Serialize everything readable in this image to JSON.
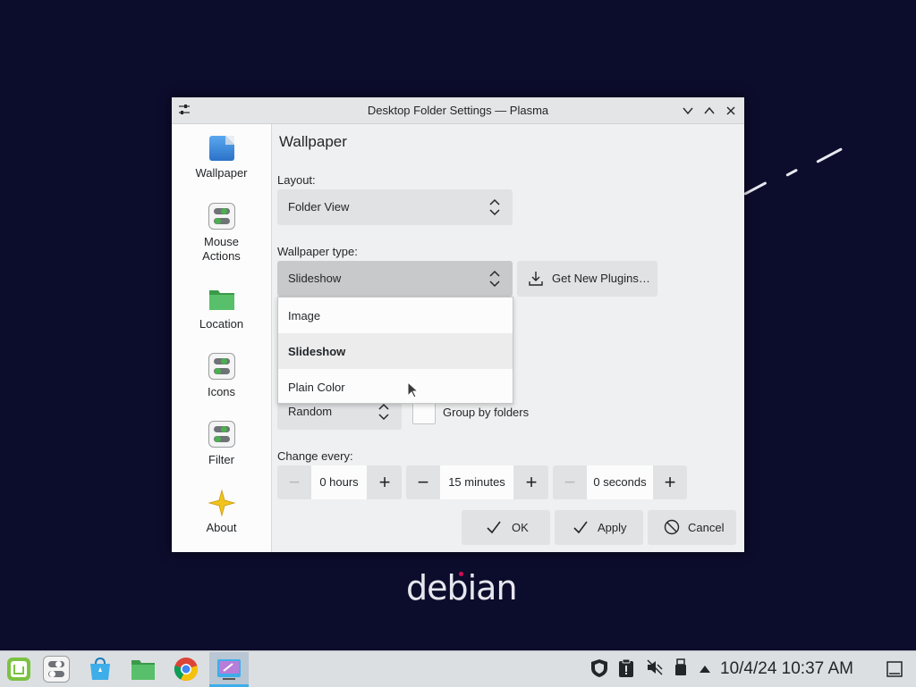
{
  "desktop": {
    "logo_text": "debian"
  },
  "window": {
    "title": "Desktop Folder Settings — Plasma",
    "controls": {
      "minimize": "∨",
      "maximize": "∧",
      "close": "✕"
    }
  },
  "sidebar": {
    "items": [
      {
        "label": "Wallpaper",
        "icon": "wallpaper-icon"
      },
      {
        "label": "Mouse\nActions",
        "icon": "toggle-icon"
      },
      {
        "label": "Location",
        "icon": "folder-icon"
      },
      {
        "label": "Icons",
        "icon": "toggle-icon"
      },
      {
        "label": "Filter",
        "icon": "toggle-icon"
      },
      {
        "label": "About",
        "icon": "star-icon"
      }
    ]
  },
  "main": {
    "title": "Wallpaper",
    "layout_label": "Layout:",
    "layout_value": "Folder View",
    "wallpaper_type_label": "Wallpaper type:",
    "wallpaper_type_value": "Slideshow",
    "get_plugins_label": "Get New Plugins…",
    "dropdown_options": [
      "Image",
      "Slideshow",
      "Plain Color"
    ],
    "dropdown_selected": "Slideshow",
    "order_value": "Random",
    "group_by_folders_label": "Group by folders",
    "group_by_folders_checked": false,
    "change_every_label": "Change every:",
    "hours_value": "0 hours",
    "minutes_value": "15 minutes",
    "seconds_value": "0 seconds",
    "minus_symbol": "−",
    "plus_symbol": "+"
  },
  "footer": {
    "ok_label": "OK",
    "apply_label": "Apply",
    "cancel_label": "Cancel"
  },
  "taskbar": {
    "clock": "10/4/24 10:37 AM",
    "apps": [
      "mint-menu-icon",
      "settings-toggle-icon",
      "software-store-icon",
      "files-icon",
      "chrome-icon",
      "desktop-settings-icon"
    ],
    "tray": [
      "shield-icon",
      "clipboard-icon",
      "volume-muted-icon",
      "usb-icon",
      "tray-expand-icon",
      "show-desktop-icon"
    ]
  },
  "colors": {
    "desktop_bg": "#0c0c2c",
    "accent": "#3daee9",
    "green": "#4bb04f"
  }
}
